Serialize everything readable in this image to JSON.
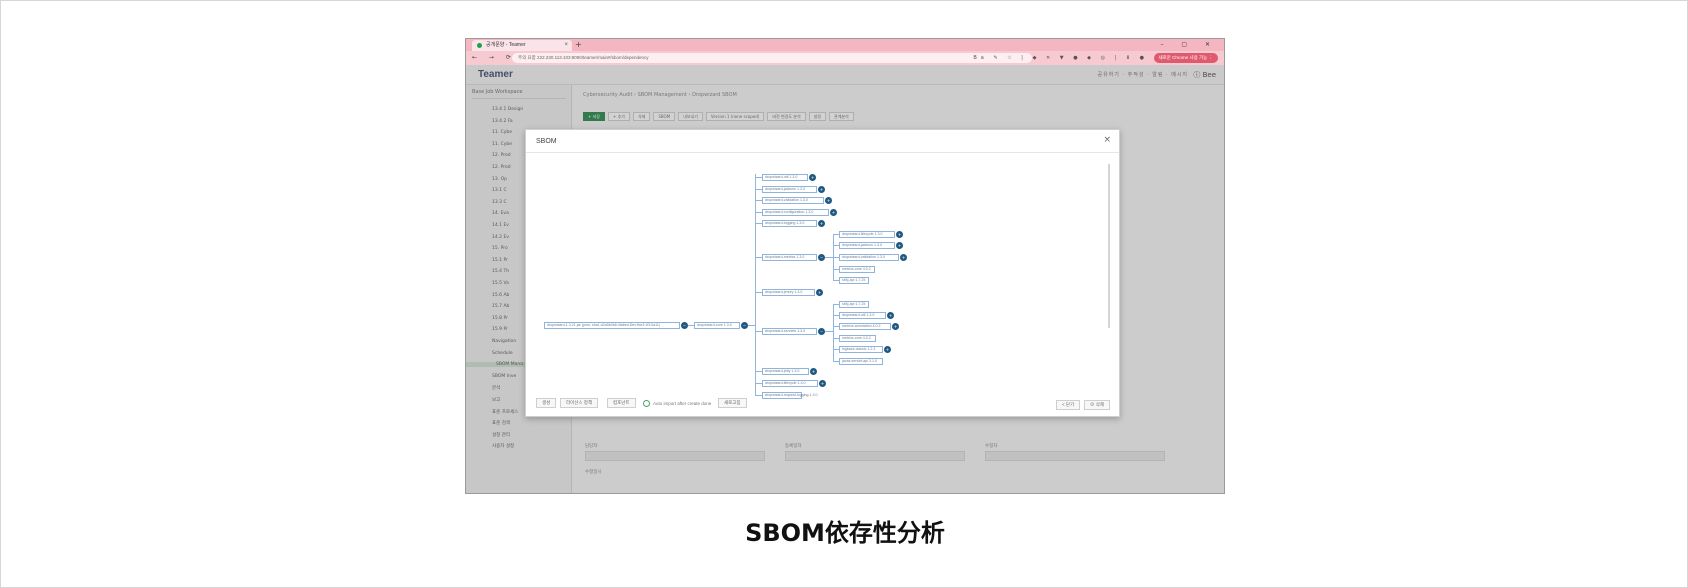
{
  "browser": {
    "tab_title": "공개문양 - Teamer",
    "new_tab": "+",
    "window_controls": "–  ▢  ✕",
    "nav_glyphs": "← → ⟳",
    "url": "주의 요함   222.230.113.103:8090/teamer/main#/sbom/dependency",
    "extension_glyphs": "Ba  ✎  ☆  |  ◆  ✕  ▼  ●  ◆  ◎  |  ⬇  ●",
    "profile": "새로운 Chrome 사용 가능 ⋮",
    "colors": {
      "tabbar": "#f4b7c2",
      "addrbar": "#f7c9d1"
    }
  },
  "app": {
    "logo": "Teamer",
    "header_links": "공유하기  ·  추적성  ·  알림  ·  메시지",
    "user": "ⓘ  Bee",
    "workspace": "Base Job Workspace",
    "breadcrumb": "Cybersecurity Audit  ›  SBOM Management  ›  Dropwizard SBOM",
    "toolbar": [
      "+ 저장",
      "+ 추가",
      "삭제",
      "SBOM",
      "내보내기",
      "Version 1 (none scoped)",
      "버전 변경도 분석",
      "설정",
      "관계분석"
    ],
    "sidebar_items": [
      {
        "label": "13.4.1 Design"
      },
      {
        "label": "13.4.2 Fa"
      },
      {
        "label": "11. Cybe"
      },
      {
        "label": "11. Cybe"
      },
      {
        "label": "12. Prod"
      },
      {
        "label": "12. Prod"
      },
      {
        "label": "13. Op"
      },
      {
        "label": "13.1 C"
      },
      {
        "label": "13.3 C"
      },
      {
        "label": "14. Eva"
      },
      {
        "label": "14.1 Ev"
      },
      {
        "label": "14.2 Ev"
      },
      {
        "label": "15. Pro"
      },
      {
        "label": "15.1 Pr"
      },
      {
        "label": "15.4 Th"
      },
      {
        "label": "15.5 Va"
      },
      {
        "label": "15.6 Ab"
      },
      {
        "label": "15.7 Ab"
      },
      {
        "label": "15.8 Pr"
      },
      {
        "label": "15.9 Pr"
      },
      {
        "label": "Navigation"
      },
      {
        "label": "Schedule"
      },
      {
        "label": "SBOM Mana",
        "highlighted": true
      },
      {
        "label": "SBOM Inve"
      },
      {
        "label": "분석"
      },
      {
        "label": "보고"
      },
      {
        "label": "표준 프로세스"
      },
      {
        "label": "표준 검색"
      },
      {
        "label": "설정 관리"
      },
      {
        "label": "사용자 설정"
      }
    ],
    "form_labels": [
      "담당자",
      "등록일자",
      "수정자",
      "수정일시"
    ]
  },
  "modal": {
    "title": "SBOM",
    "close": "×",
    "root": "dropwizard-1.3.21.jar (pom, sha1:d2a5b0b6:4fa6ed:Dev:fbe3:1f3:0a11)",
    "level1": "dropwizard-core 1.3.0",
    "children": [
      {
        "label": "dropwizard-util 1.3.0"
      },
      {
        "label": "dropwizard-jackson 1.3.0"
      },
      {
        "label": "dropwizard-validation 1.3.0"
      },
      {
        "label": "dropwizard-configuration 1.3.0"
      },
      {
        "label": "dropwizard-logging 1.3.0"
      },
      {
        "label": "dropwizard-metrics 1.3.0",
        "children": [
          {
            "label": "dropwizard-lifecycle 1.3.0"
          },
          {
            "label": "dropwizard-jackson 1.3.0"
          },
          {
            "label": "dropwizard-validation 1.3.0"
          },
          {
            "label": "metrics-core 4.0.2"
          },
          {
            "label": "slf4j-api 1.7.25"
          }
        ]
      },
      {
        "label": "dropwizard-jersey 1.3.0"
      },
      {
        "label": "dropwizard-servlets 1.3.0",
        "children": [
          {
            "label": "slf4j-api 1.7.25"
          },
          {
            "label": "dropwizard-util 1.3.0"
          },
          {
            "label": "metrics-annotation 4.0.2"
          },
          {
            "label": "metrics-core 4.0.2"
          },
          {
            "label": "logback-classic 1.2.3"
          },
          {
            "label": "javax.servlet-api 3.1.0"
          }
        ]
      },
      {
        "label": "dropwizard-jetty 1.3.0"
      },
      {
        "label": "dropwizard-lifecycle 1.3.0"
      },
      {
        "label": "dropwizard-request-logging 1.3.0"
      }
    ],
    "footer": {
      "left_buttons": [
        "생성",
        "라이선스 정책",
        "컴포넌트"
      ],
      "auto_import": "Auto import after create done",
      "refresh": "새로고침",
      "cancel": "< 닫기",
      "delete": "⊘ 삭제"
    }
  },
  "caption": "SBOM依存性分析"
}
